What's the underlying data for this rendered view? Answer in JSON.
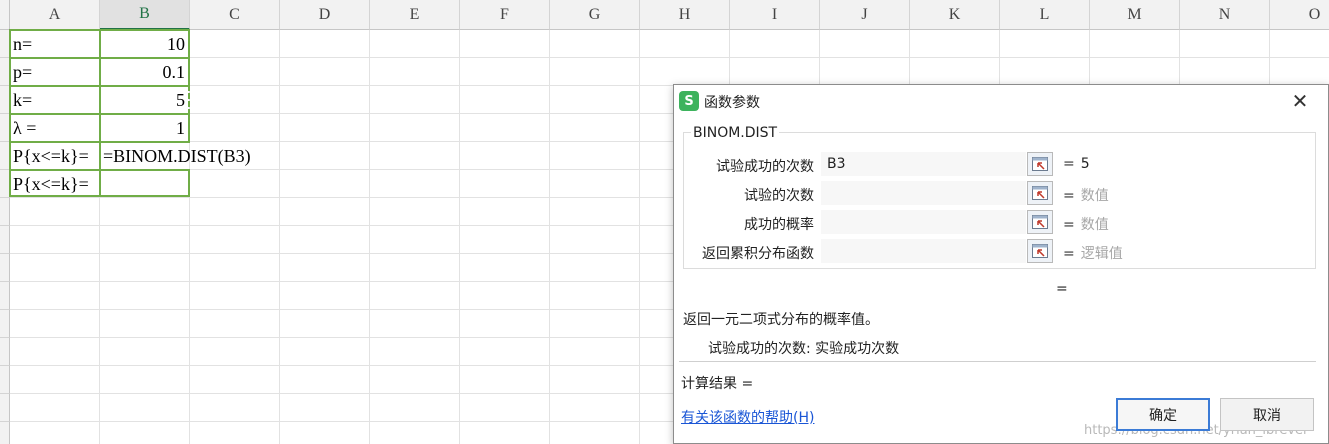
{
  "spreadsheet": {
    "columns": [
      "A",
      "B",
      "C",
      "D",
      "E",
      "F",
      "G",
      "H",
      "I",
      "J",
      "K",
      "L",
      "M",
      "N",
      "O"
    ],
    "active_column": "B",
    "cells": {
      "a1": "n=",
      "b1": "10",
      "a2": "p=",
      "b2": "0.1",
      "a3": "k=",
      "b3": "5",
      "a4": " λ =",
      "b4": "1",
      "a5": "P{x<=k}=",
      "b5": "=BINOM.DIST(B3)",
      "a6": "P{x<=k}=",
      "b6": ""
    },
    "accent_color": "#70ad47"
  },
  "dialog": {
    "icon_letter": "S",
    "title": "函数参数",
    "close_symbol": "✕",
    "function_name": "BINOM.DIST",
    "arguments": [
      {
        "label": "试验成功的次数",
        "value": "B3",
        "result": "5",
        "eq": "="
      },
      {
        "label": "试验的次数",
        "value": "",
        "result": "数值",
        "eq": "="
      },
      {
        "label": "成功的概率",
        "value": "",
        "result": "数值",
        "eq": "="
      },
      {
        "label": "返回累积分布函数",
        "value": "",
        "result": "逻辑值",
        "eq": "="
      }
    ],
    "formula_result_eq": "=",
    "description": "返回一元二项式分布的概率值。",
    "argument_description": "试验成功的次数:  实验成功次数",
    "calc_result": "计算结果  =",
    "help_link": "有关该函数的帮助(H)",
    "ok_label": "确定",
    "cancel_label": "取消",
    "watermark": "https://blog.csdn.net/yrian_lbrever"
  }
}
